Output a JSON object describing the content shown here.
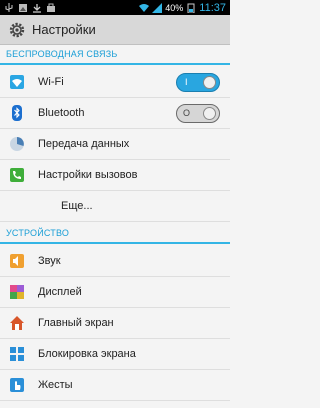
{
  "statusbar": {
    "battery_percent": "40%",
    "time": "11:37",
    "left_icons": [
      "usb-icon",
      "photo-icon",
      "download-icon",
      "bag-icon"
    ],
    "right_icons": [
      "wifi-icon",
      "signal-icon",
      "battery-icon"
    ]
  },
  "actionbar": {
    "title": "Настройки",
    "icon": "settings-gear-icon"
  },
  "sections": {
    "wireless": {
      "header": "БЕСПРОВОДНАЯ СВЯЗЬ",
      "items": [
        {
          "label": "Wi-Fi",
          "icon": "wifi-icon",
          "toggle": "on",
          "toggle_mark": "I"
        },
        {
          "label": "Bluetooth",
          "icon": "bluetooth-icon",
          "toggle": "off",
          "toggle_mark": "O"
        },
        {
          "label": "Передача данных",
          "icon": "data-usage-icon"
        },
        {
          "label": "Настройки вызовов",
          "icon": "phone-icon"
        },
        {
          "label": "Еще..."
        }
      ]
    },
    "device": {
      "header": "УСТРОЙСТВО",
      "items": [
        {
          "label": "Звук",
          "icon": "speaker-icon"
        },
        {
          "label": "Дисплей",
          "icon": "display-icon"
        },
        {
          "label": "Главный экран",
          "icon": "home-icon"
        },
        {
          "label": "Блокировка экрана",
          "icon": "lock-screen-icon"
        },
        {
          "label": "Жесты",
          "icon": "gesture-icon"
        }
      ]
    }
  },
  "colors": {
    "accent": "#33b5e5",
    "toggle_on": "#29a6e0",
    "header_text": "#1a9ed6"
  }
}
